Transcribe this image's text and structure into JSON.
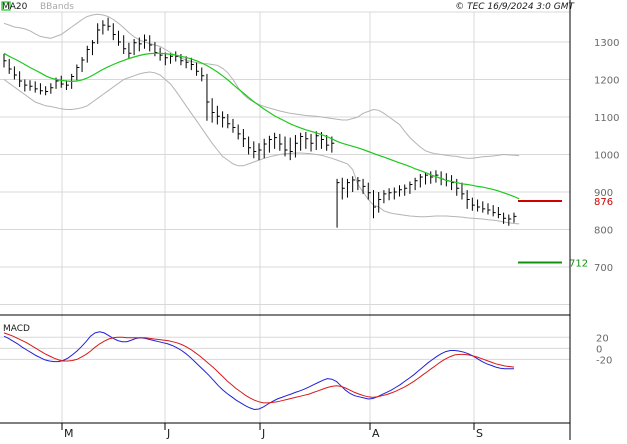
{
  "header": {
    "ma_label": "MA20",
    "bb_label": "BBands",
    "timestamp": "© TEC 16/9/2024 3:0 GMT"
  },
  "macd_panel": {
    "title": "MACD"
  },
  "colors": {
    "ma": "#1ec81e",
    "bands": "#b4b4b4",
    "bars": "#000000",
    "resistance": "#d40000",
    "support": "#109010",
    "macd_line": "#2020d8",
    "signal_line": "#d81a1a",
    "grid": "#d8d8d8"
  },
  "chart_data": [
    {
      "type": "line",
      "x_months": [
        "M",
        "J",
        "J",
        "A",
        "S"
      ],
      "y_ticks": [
        700,
        800,
        900,
        1000,
        1100,
        1200,
        1300
      ],
      "ylim": [
        580,
        1380
      ],
      "series_ohlc": [
        [
          1268,
          1232,
          1250
        ],
        [
          1255,
          1215,
          1228
        ],
        [
          1235,
          1200,
          1212
        ],
        [
          1222,
          1180,
          1196
        ],
        [
          1200,
          1168,
          1185
        ],
        [
          1198,
          1170,
          1182
        ],
        [
          1195,
          1165,
          1175
        ],
        [
          1190,
          1160,
          1170
        ],
        [
          1182,
          1158,
          1168
        ],
        [
          1190,
          1162,
          1178
        ],
        [
          1205,
          1175,
          1196
        ],
        [
          1210,
          1178,
          1188
        ],
        [
          1198,
          1172,
          1185
        ],
        [
          1215,
          1175,
          1208
        ],
        [
          1240,
          1198,
          1232
        ],
        [
          1260,
          1220,
          1252
        ],
        [
          1290,
          1245,
          1280
        ],
        [
          1305,
          1265,
          1298
        ],
        [
          1350,
          1295,
          1332
        ],
        [
          1358,
          1320,
          1345
        ],
        [
          1365,
          1330,
          1342
        ],
        [
          1350,
          1305,
          1320
        ],
        [
          1330,
          1290,
          1300
        ],
        [
          1318,
          1268,
          1282
        ],
        [
          1298,
          1255,
          1270
        ],
        [
          1308,
          1265,
          1298
        ],
        [
          1312,
          1275,
          1295
        ],
        [
          1320,
          1282,
          1305
        ],
        [
          1318,
          1275,
          1292
        ],
        [
          1300,
          1262,
          1272
        ],
        [
          1285,
          1250,
          1265
        ],
        [
          1272,
          1238,
          1258
        ],
        [
          1270,
          1242,
          1262
        ],
        [
          1275,
          1248,
          1262
        ],
        [
          1268,
          1238,
          1250
        ],
        [
          1262,
          1230,
          1246
        ],
        [
          1258,
          1225,
          1240
        ],
        [
          1245,
          1210,
          1222
        ],
        [
          1232,
          1195,
          1210
        ],
        [
          1215,
          1090,
          1140
        ],
        [
          1150,
          1085,
          1112
        ],
        [
          1130,
          1080,
          1102
        ],
        [
          1115,
          1072,
          1098
        ],
        [
          1108,
          1070,
          1082
        ],
        [
          1095,
          1058,
          1072
        ],
        [
          1080,
          1040,
          1055
        ],
        [
          1068,
          1020,
          1042
        ],
        [
          1048,
          1000,
          1018
        ],
        [
          1035,
          990,
          1008
        ],
        [
          1030,
          985,
          1012
        ],
        [
          1042,
          990,
          1028
        ],
        [
          1050,
          1005,
          1040
        ],
        [
          1058,
          1015,
          1045
        ],
        [
          1055,
          1010,
          1028
        ],
        [
          1048,
          995,
          1012
        ],
        [
          1045,
          985,
          1008
        ],
        [
          1052,
          992,
          1030
        ],
        [
          1058,
          1010,
          1048
        ],
        [
          1060,
          1015,
          1042
        ],
        [
          1055,
          1008,
          1030
        ],
        [
          1062,
          1012,
          1050
        ],
        [
          1060,
          1015,
          1040
        ],
        [
          1052,
          1010,
          1025
        ],
        [
          1048,
          1005,
          1030
        ],
        [
          935,
          805,
          925
        ],
        [
          938,
          880,
          910
        ],
        [
          935,
          885,
          925
        ],
        [
          942,
          900,
          932
        ],
        [
          940,
          905,
          930
        ],
        [
          935,
          895,
          915
        ],
        [
          925,
          880,
          898
        ],
        [
          905,
          830,
          860
        ],
        [
          900,
          845,
          880
        ],
        [
          905,
          870,
          895
        ],
        [
          910,
          878,
          898
        ],
        [
          912,
          880,
          900
        ],
        [
          918,
          888,
          906
        ],
        [
          920,
          890,
          910
        ],
        [
          928,
          895,
          920
        ],
        [
          938,
          905,
          930
        ],
        [
          948,
          912,
          940
        ],
        [
          952,
          920,
          945
        ],
        [
          955,
          922,
          940
        ],
        [
          958,
          925,
          945
        ],
        [
          955,
          918,
          935
        ],
        [
          950,
          915,
          930
        ],
        [
          945,
          905,
          925
        ],
        [
          935,
          890,
          910
        ],
        [
          925,
          880,
          895
        ],
        [
          905,
          855,
          880
        ],
        [
          885,
          850,
          865
        ],
        [
          880,
          848,
          860
        ],
        [
          875,
          845,
          855
        ],
        [
          870,
          840,
          852
        ],
        [
          865,
          835,
          845
        ],
        [
          860,
          830,
          840
        ],
        [
          845,
          815,
          830
        ],
        [
          840,
          810,
          828
        ],
        [
          845,
          818,
          835
        ]
      ],
      "ma20_values": [
        1270,
        1262,
        1255,
        1248,
        1240,
        1232,
        1225,
        1218,
        1210,
        1204,
        1200,
        1198,
        1196,
        1195,
        1196,
        1199,
        1204,
        1211,
        1219,
        1227,
        1234,
        1240,
        1246,
        1251,
        1256,
        1260,
        1264,
        1267,
        1269,
        1270,
        1270,
        1269,
        1267,
        1265,
        1262,
        1259,
        1255,
        1250,
        1244,
        1237,
        1229,
        1220,
        1210,
        1199,
        1187,
        1175,
        1164,
        1152,
        1141,
        1131,
        1121,
        1112,
        1103,
        1096,
        1089,
        1082,
        1076,
        1071,
        1066,
        1062,
        1058,
        1053,
        1048,
        1042,
        1035,
        1030,
        1026,
        1022,
        1018,
        1013,
        1008,
        1003,
        998,
        993,
        988,
        983,
        978,
        973,
        968,
        962,
        957,
        952,
        946,
        941,
        936,
        931,
        928,
        925,
        922,
        920,
        918,
        915,
        913,
        910,
        907,
        903,
        898,
        893,
        888,
        882
      ],
      "bb_upper": [
        1350,
        1345,
        1340,
        1338,
        1335,
        1330,
        1322,
        1315,
        1312,
        1310,
        1315,
        1320,
        1330,
        1340,
        1350,
        1360,
        1368,
        1372,
        1374,
        1372,
        1368,
        1360,
        1350,
        1338,
        1325,
        1314,
        1306,
        1300,
        1296,
        1292,
        1288,
        1280,
        1272,
        1264,
        1258,
        1252,
        1248,
        1245,
        1242,
        1242,
        1240,
        1238,
        1230,
        1218,
        1200,
        1178,
        1160,
        1148,
        1140,
        1133,
        1128,
        1124,
        1120,
        1116,
        1113,
        1110,
        1108,
        1106,
        1104,
        1103,
        1102,
        1100,
        1098,
        1096,
        1094,
        1092,
        1092,
        1096,
        1100,
        1110,
        1115,
        1120,
        1118,
        1110,
        1100,
        1090,
        1080,
        1062,
        1045,
        1032,
        1020,
        1010,
        1005,
        1002,
        1000,
        998,
        996,
        995,
        992,
        990,
        990,
        992,
        994,
        995,
        996,
        998,
        1000,
        999,
        998,
        997
      ],
      "bb_lower": [
        1200,
        1190,
        1180,
        1170,
        1160,
        1150,
        1140,
        1135,
        1130,
        1128,
        1125,
        1122,
        1120,
        1120,
        1122,
        1125,
        1130,
        1140,
        1150,
        1160,
        1170,
        1180,
        1190,
        1200,
        1205,
        1210,
        1215,
        1218,
        1220,
        1218,
        1212,
        1200,
        1188,
        1170,
        1150,
        1130,
        1110,
        1090,
        1070,
        1050,
        1030,
        1012,
        995,
        985,
        975,
        970,
        970,
        975,
        980,
        985,
        990,
        994,
        997,
        1000,
        1002,
        1003,
        1004,
        1004,
        1003,
        1002,
        1000,
        998,
        994,
        990,
        985,
        980,
        975,
        960,
        920,
        900,
        880,
        865,
        860,
        850,
        845,
        842,
        840,
        838,
        836,
        835,
        834,
        834,
        835,
        836,
        836,
        836,
        835,
        834,
        833,
        831,
        830,
        829,
        828,
        826,
        825,
        823,
        820,
        818,
        816,
        815
      ],
      "resistance_level": 876,
      "support_level": 712,
      "resistance_label": "876",
      "support_label": "712"
    },
    {
      "type": "line",
      "title": "MACD",
      "y_ticks": [
        "20",
        "0",
        "-20"
      ],
      "y_tick_values": [
        20,
        0,
        -20
      ],
      "ylim": [
        -130,
        55
      ],
      "macd": [
        22,
        18,
        13,
        8,
        2,
        -3,
        -8,
        -13,
        -17,
        -21,
        -23,
        -24,
        -24,
        -22,
        -18,
        -12,
        -5,
        3,
        12,
        22,
        28,
        30,
        28,
        23,
        18,
        14,
        12,
        12,
        15,
        18,
        19,
        18,
        16,
        14,
        12,
        10,
        8,
        5,
        1,
        -4,
        -10,
        -17,
        -25,
        -33,
        -41,
        -49,
        -58,
        -67,
        -75,
        -82,
        -88,
        -94,
        -99,
        -104,
        -108,
        -111,
        -110,
        -106,
        -101,
        -96,
        -92,
        -89,
        -86,
        -83,
        -80,
        -77,
        -74,
        -70,
        -66,
        -62,
        -58,
        -55,
        -56,
        -60,
        -68,
        -76,
        -82,
        -86,
        -88,
        -90,
        -92,
        -91,
        -88,
        -84,
        -80,
        -76,
        -71,
        -66,
        -60,
        -54,
        -48,
        -41,
        -34,
        -27,
        -21,
        -15,
        -10,
        -6,
        -4,
        -4,
        -5,
        -7,
        -10,
        -14,
        -19,
        -24,
        -28,
        -31,
        -34,
        -36,
        -37,
        -37,
        -37
      ],
      "signal": [
        28,
        25,
        22,
        18,
        14,
        10,
        5,
        0,
        -5,
        -10,
        -14,
        -18,
        -21,
        -23,
        -23,
        -22,
        -20,
        -16,
        -11,
        -5,
        2,
        8,
        13,
        17,
        19,
        20,
        20,
        19,
        19,
        19,
        19,
        19,
        18,
        17,
        16,
        15,
        14,
        12,
        10,
        7,
        3,
        -2,
        -8,
        -14,
        -21,
        -28,
        -35,
        -43,
        -51,
        -59,
        -66,
        -73,
        -79,
        -85,
        -90,
        -94,
        -97,
        -99,
        -99,
        -98,
        -97,
        -95,
        -93,
        -91,
        -89,
        -87,
        -85,
        -83,
        -80,
        -77,
        -74,
        -71,
        -69,
        -68,
        -69,
        -72,
        -76,
        -80,
        -83,
        -86,
        -88,
        -89,
        -88,
        -86,
        -84,
        -81,
        -78,
        -74,
        -70,
        -65,
        -60,
        -54,
        -48,
        -42,
        -36,
        -30,
        -24,
        -19,
        -15,
        -12,
        -11,
        -11,
        -12,
        -14,
        -16,
        -19,
        -22,
        -25,
        -28,
        -30,
        -32,
        -33,
        -34
      ]
    }
  ]
}
